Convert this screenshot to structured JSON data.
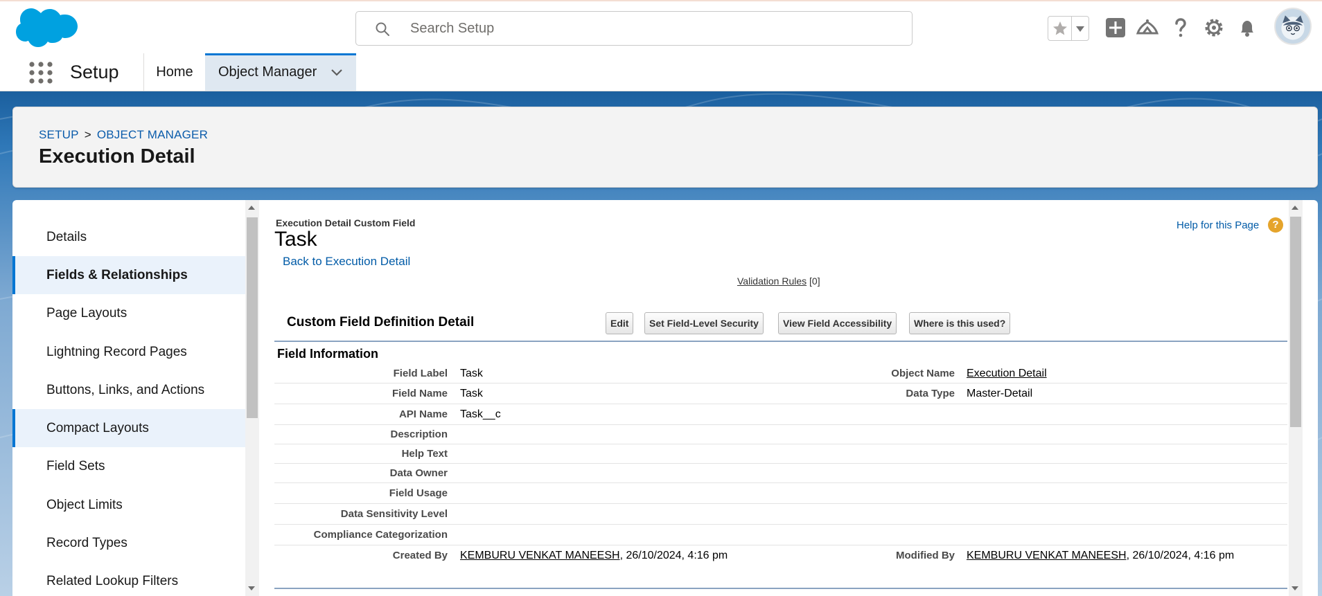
{
  "header": {
    "search_placeholder": "Search Setup",
    "icons": [
      "favorites-star-icon",
      "favorites-menu-icon",
      "global-actions-plus-icon",
      "trailhead-icon",
      "help-icon",
      "setup-gear-icon",
      "notifications-bell-icon",
      "user-avatar"
    ]
  },
  "nav": {
    "app_name": "Setup",
    "tabs": [
      {
        "label": "Home"
      },
      {
        "label": "Object Manager"
      }
    ]
  },
  "page_header": {
    "breadcrumb": [
      "SETUP",
      "OBJECT MANAGER"
    ],
    "breadcrumb_separator": ">",
    "title": "Execution Detail"
  },
  "sidebar": {
    "items": [
      {
        "label": "Details"
      },
      {
        "label": "Fields & Relationships"
      },
      {
        "label": "Page Layouts"
      },
      {
        "label": "Lightning Record Pages"
      },
      {
        "label": "Buttons, Links, and Actions"
      },
      {
        "label": "Compact Layouts"
      },
      {
        "label": "Field Sets"
      },
      {
        "label": "Object Limits"
      },
      {
        "label": "Record Types"
      },
      {
        "label": "Related Lookup Filters"
      }
    ],
    "active": "Fields & Relationships"
  },
  "content": {
    "object_type": "Execution Detail Custom Field",
    "field_name": "Task",
    "back_link": "Back to Execution Detail",
    "help_link": "Help for this Page",
    "help_icon": "?",
    "validation_rules_label": "Validation Rules",
    "validation_rules_count": "[0]",
    "detail_title": "Custom Field Definition Detail",
    "buttons": {
      "edit": "Edit",
      "field_level_security": "Set Field-Level Security",
      "view_accessibility": "View Field Accessibility",
      "where_used": "Where is this used?"
    },
    "section_title": "Field Information",
    "fields": {
      "field_label": {
        "label": "Field Label",
        "value": "Task"
      },
      "field_name": {
        "label": "Field Name",
        "value": "Task"
      },
      "api_name": {
        "label": "API Name",
        "value": "Task__c"
      },
      "description": {
        "label": "Description",
        "value": ""
      },
      "help_text": {
        "label": "Help Text",
        "value": ""
      },
      "data_owner": {
        "label": "Data Owner",
        "value": ""
      },
      "field_usage": {
        "label": "Field Usage",
        "value": ""
      },
      "data_sensitivity": {
        "label": "Data Sensitivity Level",
        "value": ""
      },
      "compliance": {
        "label": "Compliance Categorization",
        "value": ""
      },
      "created_by": {
        "label": "Created By",
        "user": "KEMBURU VENKAT MANEESH",
        "date": ", 26/10/2024, 4:16 pm"
      },
      "object_name": {
        "label": "Object Name",
        "value": "Execution Detail"
      },
      "data_type": {
        "label": "Data Type",
        "value": "Master-Detail"
      },
      "modified_by": {
        "label": "Modified By",
        "user": "KEMBURU VENKAT MANEESH",
        "date": ", 26/10/2024, 4:16 pm"
      }
    }
  },
  "colors": {
    "brand_blue": "#0176d3",
    "link": "#015ba7",
    "band_top": "#1b5f9e",
    "help_orange": "#e5a42b"
  }
}
